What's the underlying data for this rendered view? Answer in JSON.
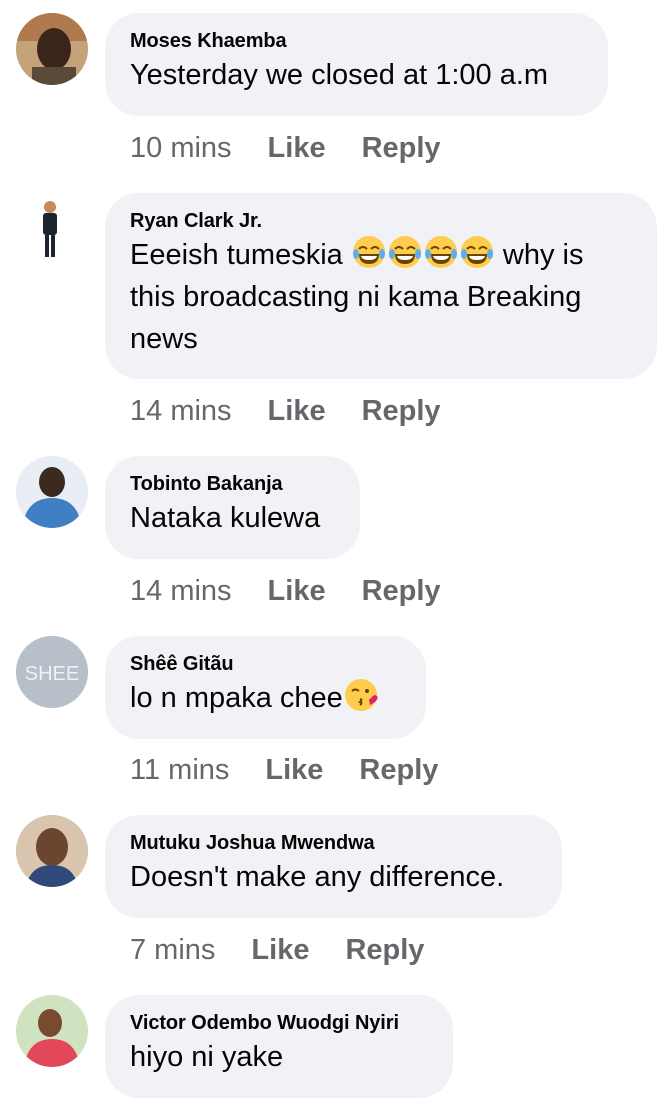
{
  "comments": [
    {
      "author": "Moses Khaemba",
      "text": "Yesterday we closed at 1:00 a.m",
      "time": "10 mins",
      "like": "Like",
      "reply": "Reply",
      "avatar_icon": "user-photo-icon"
    },
    {
      "author": "Ryan Clark Jr.",
      "text_before": "Eeeish tumeskia",
      "emoji": "face-with-tears-of-joy",
      "emoji_count": 4,
      "text_after1": " why is",
      "text_after2": "this broadcasting ni kama Breaking",
      "text_after3": "news",
      "time": "14 mins",
      "like": "Like",
      "reply": "Reply",
      "avatar_icon": "user-photo-icon"
    },
    {
      "author": "Tobinto Bakanja",
      "text": "Nataka kulewa",
      "time": "14 mins",
      "like": "Like",
      "reply": "Reply",
      "avatar_icon": "user-photo-icon"
    },
    {
      "author": "Shêê Gitãu",
      "text": "lo n mpaka chee",
      "emoji": "face-blowing-a-kiss",
      "avatar_text": "SHEE",
      "time": "11 mins",
      "like": "Like",
      "reply": "Reply",
      "avatar_icon": "user-photo-icon"
    },
    {
      "author": "Mutuku Joshua Mwendwa",
      "text": "Doesn't make any difference.",
      "time": "7 mins",
      "like": "Like",
      "reply": "Reply",
      "avatar_icon": "user-photo-icon"
    },
    {
      "author": "Victor Odembo Wuodgi Nyiri",
      "text": "hiyo ni yake",
      "avatar_icon": "user-photo-icon"
    }
  ],
  "colors": {
    "bubble": "#f0f2f5",
    "meta_text": "#65676b",
    "primary_text": "#050505",
    "emoji_yellow": "#ffcc4d"
  }
}
